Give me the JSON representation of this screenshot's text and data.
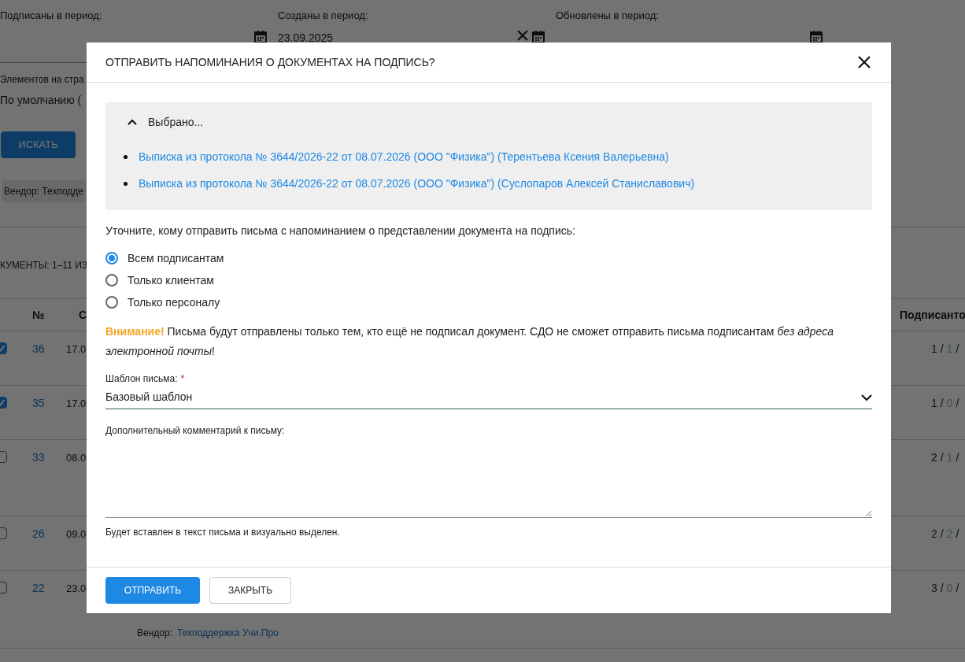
{
  "filters": [
    {
      "label": "Подписаны в период:"
    },
    {
      "label": "Созданы в период:",
      "value": "23.09.2025",
      "clearable": true
    },
    {
      "label": "Обновлены в период:"
    }
  ],
  "page_size": {
    "label": "Элементов на стра",
    "value": "По умолчанию ("
  },
  "search_button": "ИСКАТЬ",
  "chips": [
    "Вендор: Техподде"
  ],
  "results_count": "КУМЕНТЫ: 1–11 ИЗ",
  "table": {
    "columns": [
      "№",
      "С",
      "Подписанто"
    ],
    "rows": [
      {
        "selected": true,
        "number": "36",
        "date": "17.0",
        "total": "1 /",
        "signed": {
          "text": "1",
          "color": "#2f5e31"
        },
        "rest": "/"
      },
      {
        "selected": true,
        "number": "35",
        "date": "17.0",
        "total": "1 /",
        "signed": {
          "text": "0",
          "color": "#4a4a4a"
        },
        "rest": "/"
      },
      {
        "selected": false,
        "number": "33",
        "date": "08.0",
        "total": "2 /",
        "signed": {
          "text": "1",
          "color": "#2f5e31"
        },
        "rest": "/"
      },
      {
        "selected": false,
        "number": "26",
        "date": "09.0",
        "total": "2 /",
        "signed": {
          "text": "2",
          "color": "#2f5e31"
        },
        "rest": "/"
      },
      {
        "selected": false,
        "number": "22",
        "date": "23.0",
        "total": "3 /",
        "signed": {
          "text": "0",
          "color": "#4a4a4a"
        },
        "rest": "/",
        "vendor_label": "Вендор:",
        "vendor": "Техподдержка Учи.Про"
      }
    ]
  },
  "dialog": {
    "title": "ОТПРАВИТЬ НАПОМИНАНИЯ О ДОКУМЕНТАХ НА ПОДПИСЬ?",
    "selected_panel": {
      "title": "Выбрано...",
      "expanded": true,
      "items": [
        "Выписка из протокола № 3644/2026-22 от 08.07.2026 (ООО \"Физика\") (Терентьева Ксения Валерьевна)",
        "Выписка из протокола № 3644/2026-22 от 08.07.2026 (ООО \"Физика\") (Суслопаров Алексей Станиславович)"
      ]
    },
    "question": "Уточните, кому отправить письма с напоминанием о представлении документа на подпись:",
    "recipients": [
      {
        "label": "Всем подписантам",
        "selected": true
      },
      {
        "label": "Только клиентам",
        "selected": false
      },
      {
        "label": "Только персоналу",
        "selected": false
      }
    ],
    "warning": "**Внимание!** Письма будут отправлены только тем, кто ещё не подписал документ. СДО не сможет отправить письма подписантам *без адреса электронной почты*!",
    "template": {
      "label": "Шаблон письма:",
      "required_mark": "*",
      "value": "Базовый шаблон"
    },
    "comment": {
      "label": "Дополнительный комментарий к письму:",
      "hint": "Будет вставлен в текст письма и визуально выделен."
    },
    "buttons": [
      {
        "label": "ОТПРАВИТЬ",
        "kind": "primary"
      },
      {
        "label": "ЗАКРЫТЬ",
        "kind": "secondary"
      }
    ]
  }
}
